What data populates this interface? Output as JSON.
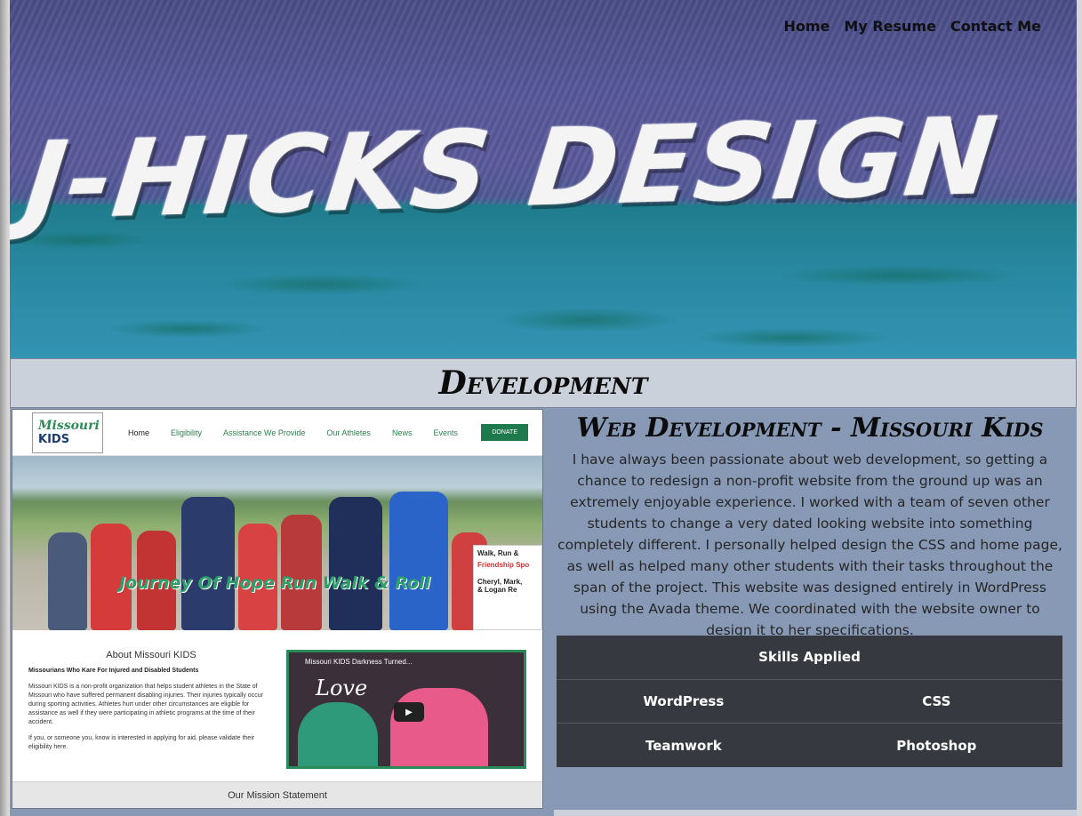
{
  "nav": {
    "items": [
      "Home",
      "My Resume",
      "Contact Me"
    ]
  },
  "hero": {
    "title": "J-HICKS DESIGN"
  },
  "section": {
    "title": "Development"
  },
  "preview": {
    "logo_line1": "Missouri",
    "logo_line2": "KIDS",
    "nav_items": [
      "Home",
      "Eligibility",
      "Assistance We Provide",
      "Our Athletes",
      "News",
      "Events"
    ],
    "donate_label": "DONATE",
    "photo_caption": "Journey Of Hope Run Walk & Roll",
    "sign_lines": [
      "Walk, Run &",
      "Friendship Spo",
      "Cheryl, Mark,",
      "& Logan Re"
    ],
    "about_title": "About Missouri KIDS",
    "about_subtitle": "Missourians Who Kare For Injured and Disabled Students",
    "about_p1": "Missouri KIDS is a non-profit organization that helps student athletes in the State of Missouri who have suffered permanent disabling injuries. Their injuries typically occur during sporting activities. Athletes hurt under other circumstances are eligible for assistance as well if they were participating in athletic programs at the time of their accident.",
    "about_p2": "If you, or someone you, know is interested in applying for aid, please validate their eligibility here.",
    "video_title": "Missouri KIDS Darkness Turned...",
    "video_overlay": "Love",
    "mission_label": "Our Mission Statement"
  },
  "project": {
    "title": "Web Development - Missouri Kids",
    "description": "I have always been passionate about web development, so getting a chance to redesign a non-profit website from the ground up was an extremely enjoyable experience. I worked with a team of seven other students to change a very dated looking website into something completely different. I personally helped design the CSS and home page, as well as helped many other students with their tasks throughout the span of the project. This website was designed entirely in WordPress using the Avada theme. We coordinated with the website owner to design it to her specifications.",
    "skills_header": "Skills Applied",
    "skills": [
      [
        "WordPress",
        "CSS"
      ],
      [
        "Teamwork",
        "Photoshop"
      ]
    ]
  },
  "colors": {
    "page_bg": "#8a9bb8",
    "section_header_bg": "#cbd1db",
    "skills_bg": "#363a40",
    "preview_accent": "#2e8b57"
  }
}
